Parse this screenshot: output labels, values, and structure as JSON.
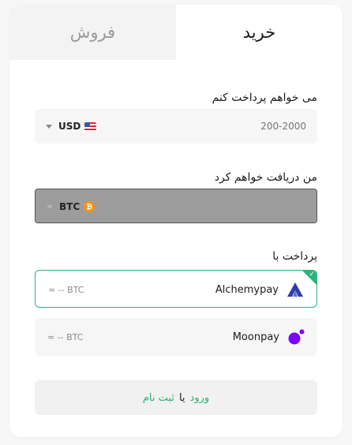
{
  "tabs": {
    "buy": "خرید",
    "sell": "فروش"
  },
  "pay": {
    "label": "می خواهم پرداخت کنم",
    "currency": "USD",
    "amount_placeholder": "200-2000"
  },
  "receive": {
    "label": "من دریافت خواهم کرد",
    "currency": "BTC"
  },
  "payment": {
    "label": "پرداخت با",
    "providers": [
      {
        "name": "Alchemypay",
        "quote": "≈ -- BTC",
        "selected": true,
        "icon": "alchemypay-icon"
      },
      {
        "name": "Moonpay",
        "quote": "≈ -- BTC",
        "selected": false,
        "icon": "moonpay-icon"
      }
    ]
  },
  "auth": {
    "login": "ورود",
    "or": "یا",
    "register": "ثبت نام"
  },
  "colors": {
    "accent": "#27b273",
    "btc": "#f7931a",
    "moonpay": "#7d00ff",
    "alchemy": "#2f3ea8"
  }
}
